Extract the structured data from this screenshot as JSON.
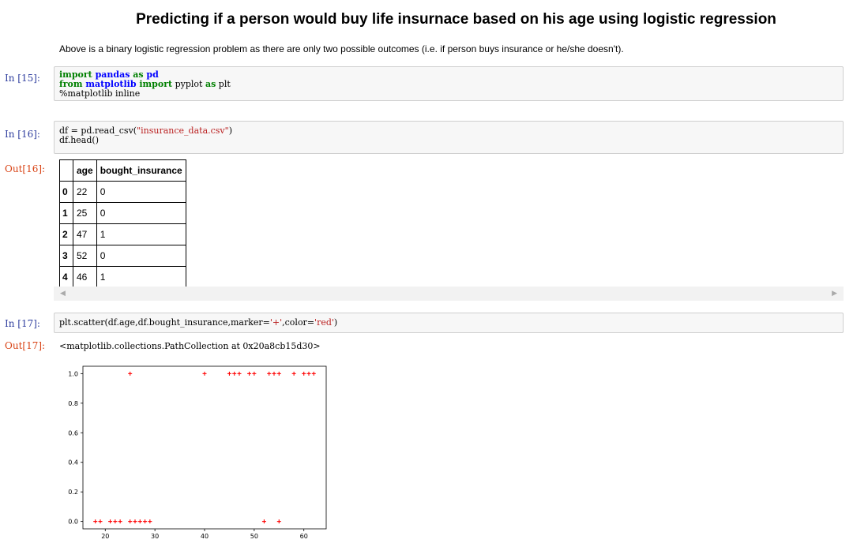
{
  "notebook": {
    "title": "Predicting if a person would buy life insurnace based on his age using logistic regression",
    "intro": "Above is a binary logistic regression problem as there are only two possible outcomes (i.e. if person buys insurance or he/she doesn't).",
    "cells": {
      "c15": {
        "prompt": "In  [15]:",
        "line1_kw1": "import",
        "line1_mod": " pandas ",
        "line1_kw2": "as",
        "line1_alias": " pd",
        "line2_kw1": "from",
        "line2_mod": " matplotlib ",
        "line2_kw2": "import",
        "line2_mid": " pyplot ",
        "line2_kw3": "as",
        "line2_alias": " plt",
        "line3": "%matplotlib inline"
      },
      "c16": {
        "prompt": "In  [16]:",
        "line1_a": "df = pd.read_csv(",
        "line1_str": "\"insurance_data.csv\"",
        "line1_b": ")",
        "line2": "df.head()",
        "out_prompt": "Out[16]:"
      },
      "c17": {
        "prompt": "In  [17]:",
        "code_a": "plt.scatter(df.age,df.bought_insurance,marker=",
        "code_s1": "'+'",
        "code_b": ",color=",
        "code_s2": "'red'",
        "code_c": ")",
        "out_prompt": "Out[17]:",
        "out_text": "<matplotlib.collections.PathCollection at 0x20a8cb15d30>"
      }
    },
    "table": {
      "columns": [
        "",
        "age",
        "bought_insurance"
      ],
      "rows": [
        {
          "idx": "0",
          "age": "22",
          "bought": "0"
        },
        {
          "idx": "1",
          "age": "25",
          "bought": "0"
        },
        {
          "idx": "2",
          "age": "47",
          "bought": "1"
        },
        {
          "idx": "3",
          "age": "52",
          "bought": "0"
        },
        {
          "idx": "4",
          "age": "46",
          "bought": "1"
        }
      ]
    },
    "scrollbar": {
      "left_icon": "chevron-left-icon",
      "right_icon": "chevron-right-icon"
    }
  },
  "chart_data": {
    "type": "scatter",
    "marker": "+",
    "color": "#ff0000",
    "title": "",
    "xlabel": "",
    "ylabel": "",
    "xlim": [
      15.5,
      64.5
    ],
    "ylim": [
      -0.05,
      1.05
    ],
    "xticks": [
      20,
      30,
      40,
      50,
      60
    ],
    "yticks": [
      0.0,
      0.2,
      0.4,
      0.6,
      0.8,
      1.0
    ],
    "xtick_labels": [
      "20",
      "30",
      "40",
      "50",
      "60"
    ],
    "ytick_labels": [
      "0.0",
      "0.2",
      "0.4",
      "0.6",
      "0.8",
      "1.0"
    ],
    "grid": false,
    "points": [
      {
        "x": 18,
        "y": 0
      },
      {
        "x": 19,
        "y": 0
      },
      {
        "x": 21,
        "y": 0
      },
      {
        "x": 22,
        "y": 0
      },
      {
        "x": 23,
        "y": 0
      },
      {
        "x": 25,
        "y": 0
      },
      {
        "x": 26,
        "y": 0
      },
      {
        "x": 27,
        "y": 0
      },
      {
        "x": 28,
        "y": 0
      },
      {
        "x": 29,
        "y": 0
      },
      {
        "x": 25,
        "y": 1
      },
      {
        "x": 40,
        "y": 1
      },
      {
        "x": 45,
        "y": 1
      },
      {
        "x": 46,
        "y": 1
      },
      {
        "x": 47,
        "y": 1
      },
      {
        "x": 49,
        "y": 1
      },
      {
        "x": 50,
        "y": 1
      },
      {
        "x": 52,
        "y": 0
      },
      {
        "x": 55,
        "y": 0
      },
      {
        "x": 53,
        "y": 1
      },
      {
        "x": 54,
        "y": 1
      },
      {
        "x": 55,
        "y": 1
      },
      {
        "x": 58,
        "y": 1
      },
      {
        "x": 60,
        "y": 1
      },
      {
        "x": 61,
        "y": 1
      },
      {
        "x": 62,
        "y": 1
      }
    ]
  }
}
